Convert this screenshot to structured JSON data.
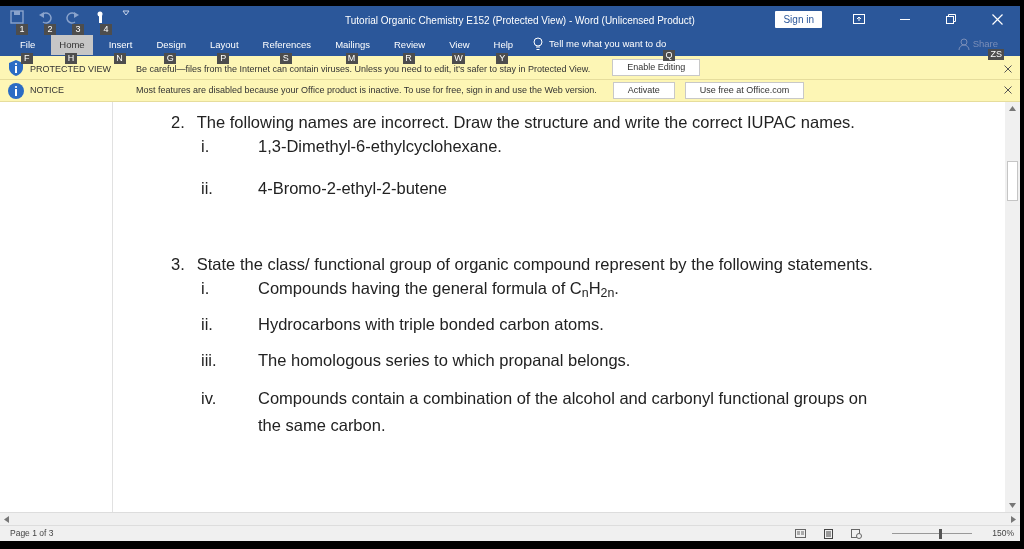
{
  "quick_access": [
    {
      "keytip": "1"
    },
    {
      "keytip": "2"
    },
    {
      "keytip": "3"
    },
    {
      "keytip": "4"
    }
  ],
  "window": {
    "title": "Tutorial Organic Chemistry E152 (Protected View)  -  Word (Unlicensed Product)",
    "sign_in": "Sign in"
  },
  "tabs": [
    {
      "label": "File",
      "keytip": "F",
      "selected": false
    },
    {
      "label": "Home",
      "keytip": "H",
      "selected": true
    },
    {
      "label": "Insert",
      "keytip": "N",
      "selected": false
    },
    {
      "label": "Design",
      "keytip": "G",
      "selected": false
    },
    {
      "label": "Layout",
      "keytip": "P",
      "selected": false
    },
    {
      "label": "References",
      "keytip": "S",
      "selected": false
    },
    {
      "label": "Mailings",
      "keytip": "M",
      "selected": false
    },
    {
      "label": "Review",
      "keytip": "R",
      "selected": false
    },
    {
      "label": "View",
      "keytip": "W",
      "selected": false
    },
    {
      "label": "Help",
      "keytip": "Y",
      "selected": false
    }
  ],
  "tell_me": {
    "placeholder": "Tell me what you want to do",
    "keytip": "Q"
  },
  "share": {
    "label": "Share",
    "keytip": "ZS"
  },
  "message_bars": [
    {
      "title": "PROTECTED VIEW",
      "text": "Be careful—files from the Internet can contain viruses. Unless you need to edit, it's safer to stay in Protected View.",
      "buttons": [
        "Enable Editing"
      ]
    },
    {
      "title": "NOTICE",
      "text": "Most features are disabled because your Office product is inactive. To use for free, sign in and use the Web version.",
      "buttons": [
        "Activate",
        "Use free at Office.com"
      ]
    }
  ],
  "document": {
    "questions": [
      {
        "number": "2.",
        "text": "The following names are incorrect. Draw the structure and write the correct IUPAC names.",
        "items": [
          {
            "marker": "i.",
            "text": "1,3-Dimethyl-6-ethylcyclohexane."
          },
          {
            "marker": "ii.",
            "text": "4-Bromo-2-ethyl-2-butene"
          }
        ]
      },
      {
        "number": "3.",
        "text": "State the class/ functional group of organic compound represent by the following statements.",
        "items": [
          {
            "marker": "i.",
            "text": "Compounds having the general formula of C$_{n}$H$_{2n}$."
          },
          {
            "marker": "ii.",
            "text": "Hydrocarbons with triple bonded carbon atoms."
          },
          {
            "marker": "iii.",
            "text": "The homologous series to which propanal belongs."
          },
          {
            "marker": "iv.",
            "text": "Compounds contain a combination of the alcohol and carbonyl functional groups on the same carbon."
          }
        ]
      }
    ]
  },
  "status_bar": {
    "page": "Page 1 of 3",
    "zoom": "150%",
    "zoom_slider": {
      "level": 0.6
    }
  }
}
